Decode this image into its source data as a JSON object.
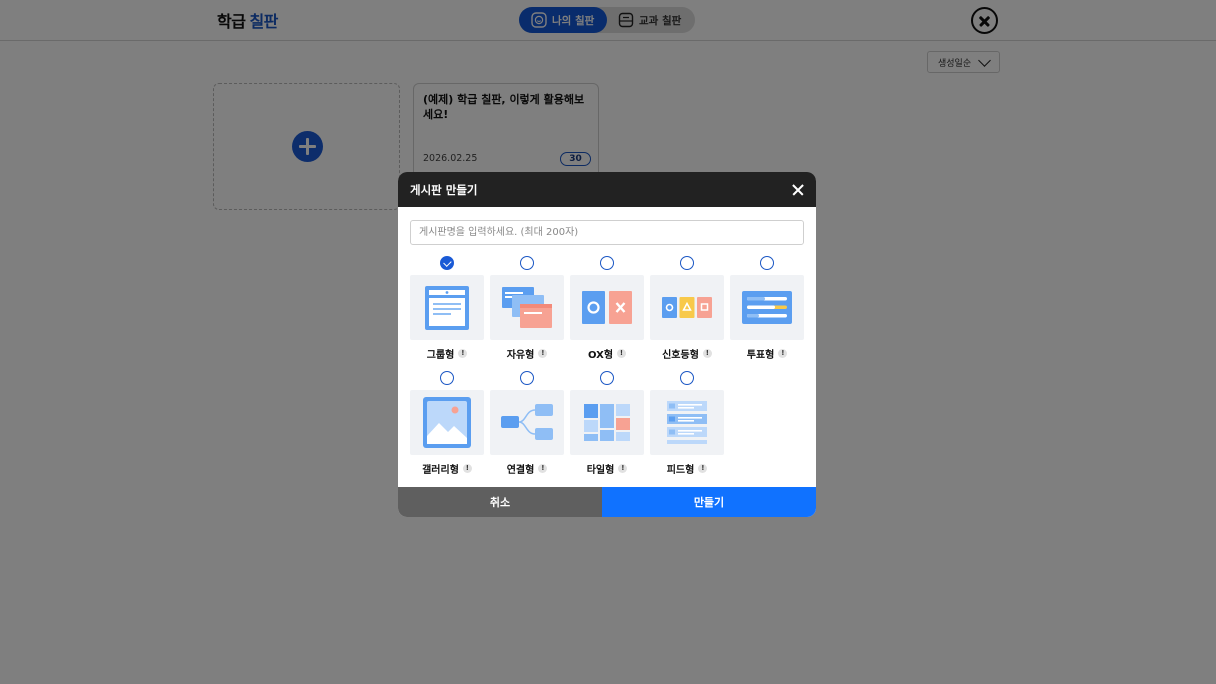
{
  "header": {
    "brand_main": "학급",
    "brand_accent": "칠판",
    "tabs": [
      {
        "label": "나의 칠판",
        "active": true
      },
      {
        "label": "교과 칠판",
        "active": false
      }
    ]
  },
  "toolbar": {
    "sort_label": "생성일순"
  },
  "boards": [
    {
      "title": "(예제) 학급 칠판, 이렇게 활용해보세요!",
      "date": "2026.02.25",
      "count": "30"
    }
  ],
  "modal": {
    "title": "게시판 만들기",
    "name_placeholder": "게시판명을 입력하세요. (최대 200자)",
    "types": [
      {
        "label": "그룹형",
        "selected": true,
        "icon": "group-board-icon"
      },
      {
        "label": "자유형",
        "selected": false,
        "icon": "free-board-icon"
      },
      {
        "label": "OX형",
        "selected": false,
        "icon": "ox-board-icon"
      },
      {
        "label": "신호등형",
        "selected": false,
        "icon": "signal-board-icon"
      },
      {
        "label": "투표형",
        "selected": false,
        "icon": "vote-board-icon"
      },
      {
        "label": "갤러리형",
        "selected": false,
        "icon": "gallery-board-icon"
      },
      {
        "label": "연결형",
        "selected": false,
        "icon": "connect-board-icon"
      },
      {
        "label": "타일형",
        "selected": false,
        "icon": "tile-board-icon"
      },
      {
        "label": "피드형",
        "selected": false,
        "icon": "feed-board-icon"
      }
    ],
    "info_mark": "!",
    "cancel_label": "취소",
    "create_label": "만들기"
  },
  "colors": {
    "primary": "#1072ff",
    "brand_blue": "#1a56c4",
    "header_dark": "#222222",
    "cancel_gray": "#5f5f5f",
    "thumb_blue": "#5b9ef0",
    "thumb_salmon": "#f7a293"
  }
}
